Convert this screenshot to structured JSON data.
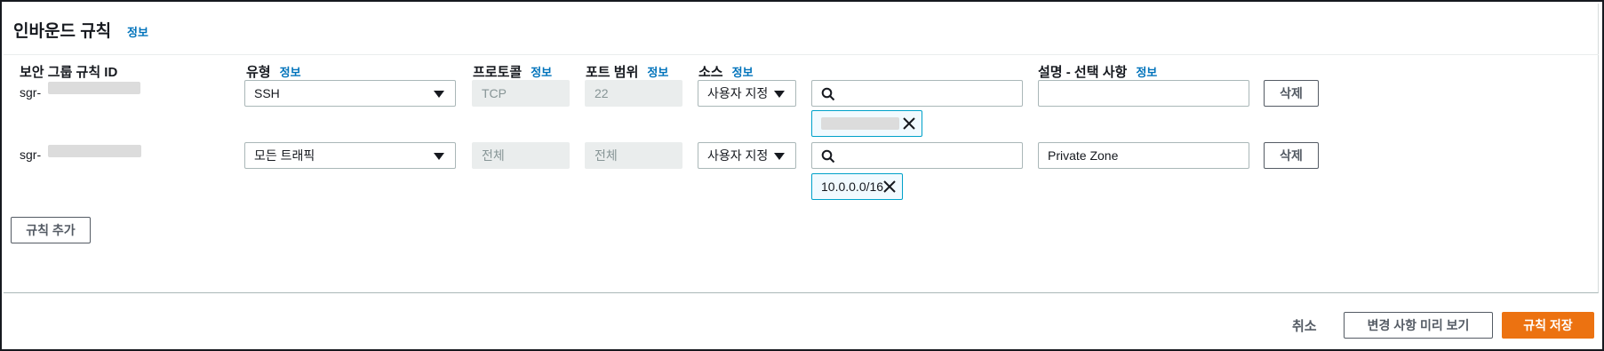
{
  "panel": {
    "title": "인바운드 규칙",
    "title_info": "정보"
  },
  "columns": {
    "rule_id": "보안 그룹 규칙 ID",
    "type": "유형",
    "type_info": "정보",
    "protocol": "프로토콜",
    "protocol_info": "정보",
    "port_range": "포트 범위",
    "port_range_info": "정보",
    "source": "소스",
    "source_info": "정보",
    "description": "설명 - 선택 사항",
    "description_info": "정보"
  },
  "rules": [
    {
      "id_prefix": "sgr-",
      "type": "SSH",
      "protocol": "TCP",
      "port_range": "22",
      "source_mode": "사용자 지정",
      "source_search_value": "",
      "source_token": "",
      "description": "",
      "delete_label": "삭제"
    },
    {
      "id_prefix": "sgr-",
      "type": "모든 트래픽",
      "protocol": "전체",
      "port_range": "전체",
      "source_mode": "사용자 지정",
      "source_search_value": "",
      "source_token": "10.0.0.0/16",
      "description": "Private Zone",
      "delete_label": "삭제"
    }
  ],
  "add_rule_label": "규칙 추가",
  "footer": {
    "cancel_label": "취소",
    "preview_label": "변경 사항 미리 보기",
    "save_label": "규칙 저장"
  },
  "colors": {
    "link": "#0073bb",
    "primary": "#ec7211",
    "token_border": "#00a1c9"
  }
}
